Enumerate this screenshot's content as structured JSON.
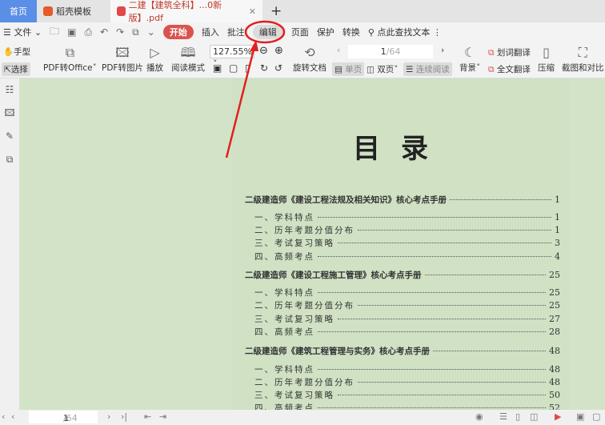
{
  "tabs": [
    {
      "label": "首页"
    },
    {
      "label": "稻壳模板"
    },
    {
      "label": "二建【建筑全科】...0新版】.pdf"
    }
  ],
  "menu": {
    "file": "文件",
    "items": [
      "开始",
      "插入",
      "批注",
      "编辑",
      "页面",
      "保护",
      "转换"
    ],
    "search": "点此查找文本"
  },
  "toolbar": {
    "hand": "手型",
    "select": "选择",
    "pdf_office": "PDF转Office",
    "pdf_image": "PDF转图片",
    "play": "播放",
    "read_mode": "阅读模式",
    "zoom": "127.55%",
    "rotate": "旋转文档",
    "page_current": "1",
    "page_total": "/64",
    "single": "单页",
    "double": "双页",
    "continuous": "连续阅读",
    "background": "背景",
    "word_translate": "划词翻译",
    "full_translate": "全文翻译",
    "compress": "压缩",
    "screenshot": "截图和对比"
  },
  "document": {
    "title": "目录",
    "toc": [
      {
        "type": "h",
        "text": "二级建造师《建设工程法规及相关知识》核心考点手册",
        "page": "1"
      },
      {
        "type": "i",
        "text": "一、学科特点",
        "page": "1"
      },
      {
        "type": "i",
        "text": "二、历年考题分值分布",
        "page": "1"
      },
      {
        "type": "i",
        "text": "三、考试复习策略",
        "page": "3"
      },
      {
        "type": "i",
        "text": "四、高频考点",
        "page": "4"
      },
      {
        "type": "h",
        "text": "二级建造师《建设工程施工管理》核心考点手册",
        "page": "25"
      },
      {
        "type": "i",
        "text": "一、学科特点",
        "page": "25"
      },
      {
        "type": "i",
        "text": "二、历年考题分值分布",
        "page": "25"
      },
      {
        "type": "i",
        "text": "三、考试复习策略",
        "page": "27"
      },
      {
        "type": "i",
        "text": "四、高频考点",
        "page": "28"
      },
      {
        "type": "h",
        "text": "二级建造师《建筑工程管理与实务》核心考点手册",
        "page": "48"
      },
      {
        "type": "i",
        "text": "一、学科特点",
        "page": "48"
      },
      {
        "type": "i",
        "text": "二、历年考题分值分布",
        "page": "48"
      },
      {
        "type": "i",
        "text": "三、考试复习策略",
        "page": "50"
      },
      {
        "type": "i",
        "text": "四、高频考点",
        "page": "52"
      }
    ]
  },
  "status": {
    "page_current": "1",
    "page_total": "/64"
  },
  "colors": {
    "accent": "#d9534f",
    "annotation": "#e02020",
    "doc_bg": "#d3e3c7"
  }
}
